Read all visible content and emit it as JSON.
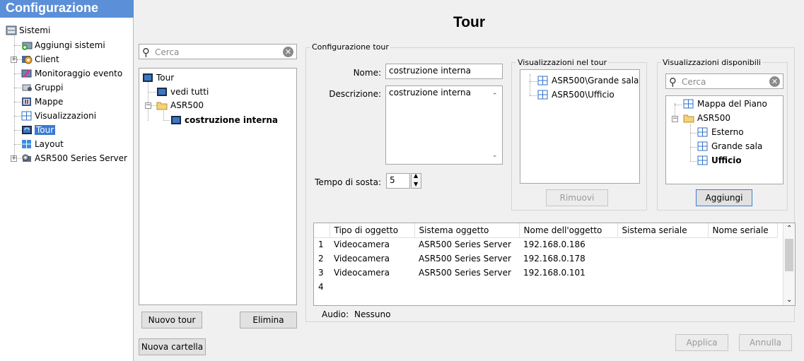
{
  "nav": {
    "title": "Configurazione",
    "items": [
      {
        "label": "Sistemi"
      },
      {
        "label": "Aggiungi sistemi"
      },
      {
        "label": "Client"
      },
      {
        "label": "Monitoraggio evento"
      },
      {
        "label": "Gruppi"
      },
      {
        "label": "Mappe"
      },
      {
        "label": "Visualizzazioni"
      },
      {
        "label": "Tour"
      },
      {
        "label": "Layout"
      },
      {
        "label": "ASR500 Series Server"
      }
    ]
  },
  "page_title": "Tour",
  "tour_list": {
    "search_placeholder": "Cerca",
    "tree": [
      "Tour",
      "vedi tutti",
      "ASR500",
      "costruzione interna"
    ],
    "new_tour": "Nuovo tour",
    "delete": "Elimina",
    "new_folder": "Nuova cartella"
  },
  "config": {
    "group_label": "Configurazione tour",
    "name_label": "Nome:",
    "name_value": "costruzione interna",
    "desc_label": "Descrizione:",
    "desc_value": "costruzione interna",
    "dwell_label": "Tempo di sosta:",
    "dwell_value": "5",
    "in_tour": {
      "label": "Visualizzazioni nel tour",
      "items": [
        "ASR500\\Grande sala",
        "ASR500\\Ufficio"
      ],
      "remove": "Rimuovi"
    },
    "available": {
      "label": "Visualizzazioni disponibili",
      "search_placeholder": "Cerca",
      "tree": [
        "Mappa del Piano",
        "ASR500",
        "Esterno",
        "Grande sala",
        "Ufficio"
      ],
      "add": "Aggiungi"
    }
  },
  "grid": {
    "columns": [
      "Tipo di oggetto",
      "Sistema oggetto",
      "Nome dell'oggetto",
      "Sistema seriale",
      "Nome seriale"
    ],
    "rows": [
      {
        "n": "1",
        "type": "Videocamera",
        "system": "ASR500 Series Server",
        "name": "192.168.0.186"
      },
      {
        "n": "2",
        "type": "Videocamera",
        "system": "ASR500 Series Server",
        "name": "192.168.0.178"
      },
      {
        "n": "3",
        "type": "Videocamera",
        "system": "ASR500 Series Server",
        "name": "192.168.0.101"
      },
      {
        "n": "4",
        "type": "",
        "system": "",
        "name": ""
      }
    ],
    "audio_label": "Audio:",
    "audio_value": "Nessuno"
  },
  "footer": {
    "apply": "Applica",
    "cancel": "Annulla"
  }
}
